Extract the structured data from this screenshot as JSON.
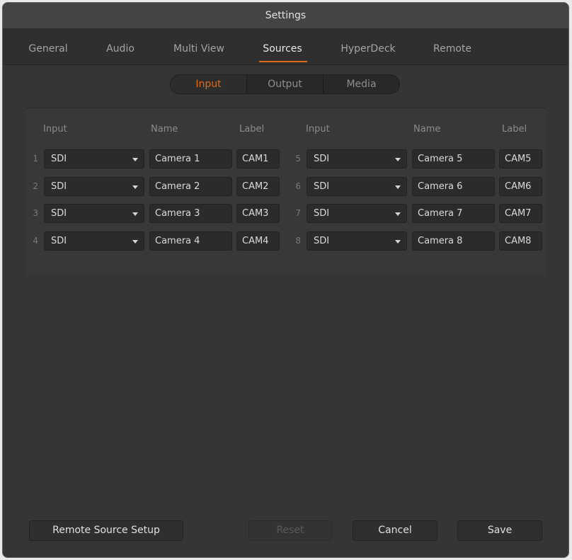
{
  "window": {
    "title": "Settings"
  },
  "tabs": [
    {
      "label": "General"
    },
    {
      "label": "Audio"
    },
    {
      "label": "Multi View"
    },
    {
      "label": "Sources"
    },
    {
      "label": "HyperDeck"
    },
    {
      "label": "Remote"
    }
  ],
  "active_tab": "Sources",
  "segments": [
    {
      "label": "Input"
    },
    {
      "label": "Output"
    },
    {
      "label": "Media"
    }
  ],
  "active_segment": "Input",
  "columns": {
    "input": "Input",
    "name": "Name",
    "label": "Label"
  },
  "rows": [
    {
      "num": "1",
      "input": "SDI",
      "name": "Camera 1",
      "label": "CAM1"
    },
    {
      "num": "2",
      "input": "SDI",
      "name": "Camera 2",
      "label": "CAM2"
    },
    {
      "num": "3",
      "input": "SDI",
      "name": "Camera 3",
      "label": "CAM3"
    },
    {
      "num": "4",
      "input": "SDI",
      "name": "Camera 4",
      "label": "CAM4"
    },
    {
      "num": "5",
      "input": "SDI",
      "name": "Camera 5",
      "label": "CAM5"
    },
    {
      "num": "6",
      "input": "SDI",
      "name": "Camera 6",
      "label": "CAM6"
    },
    {
      "num": "7",
      "input": "SDI",
      "name": "Camera 7",
      "label": "CAM7"
    },
    {
      "num": "8",
      "input": "SDI",
      "name": "Camera 8",
      "label": "CAM8"
    }
  ],
  "buttons": {
    "remote_source_setup": "Remote Source Setup",
    "reset": "Reset",
    "cancel": "Cancel",
    "save": "Save"
  },
  "colors": {
    "accent": "#e06a16",
    "background": "#353535"
  }
}
